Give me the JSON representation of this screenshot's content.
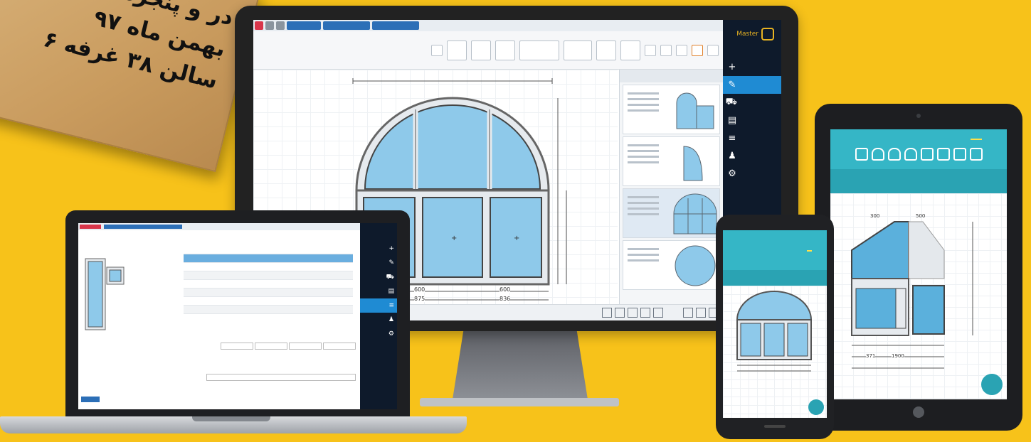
{
  "sign": {
    "line1": "در و پنجره",
    "line2": "بهمن ماه ۹۷",
    "line3": "سالن ۳۸ غرفه ۶"
  },
  "desktop": {
    "brand": "Master",
    "panel_header": "",
    "sidebar": [
      {
        "icon": "plus-icon",
        "glyph": "+",
        "active": false
      },
      {
        "icon": "pencil-icon",
        "glyph": "✎",
        "active": true
      },
      {
        "icon": "cart-icon",
        "glyph": "⛟",
        "active": false
      },
      {
        "icon": "document-icon",
        "glyph": "▤",
        "active": false
      },
      {
        "icon": "list-icon",
        "glyph": "≡",
        "active": false
      },
      {
        "icon": "user-icon",
        "glyph": "♟",
        "active": false
      },
      {
        "icon": "gear-icon",
        "glyph": "⚙",
        "active": false
      }
    ],
    "dimensions": {
      "bottom_row1_left": "600",
      "bottom_row1_right": "600",
      "bottom_row2_left": "875",
      "bottom_row2_right": "836"
    }
  },
  "laptop": {
    "sidebar": [
      {
        "icon": "plus-icon",
        "glyph": "+",
        "active": false
      },
      {
        "icon": "pencil-icon",
        "glyph": "✎",
        "active": false
      },
      {
        "icon": "cart-icon",
        "glyph": "⛟",
        "active": false
      },
      {
        "icon": "document-icon",
        "glyph": "▤",
        "active": false
      },
      {
        "icon": "list-icon",
        "glyph": "≡",
        "active": true
      },
      {
        "icon": "user-icon",
        "glyph": "♟",
        "active": false
      },
      {
        "icon": "gear-icon",
        "glyph": "⚙",
        "active": false
      }
    ]
  },
  "tablet": {
    "fab_label": "",
    "dims": {
      "top_a": "300",
      "top_b": "500",
      "bottom_a": "371",
      "bottom_b": "1900"
    }
  },
  "phone": {
    "dims": {
      "a": "",
      "b": ""
    }
  },
  "colors": {
    "background": "#f7c21a",
    "glass": "#8ec9ea",
    "accent": "#1f8bd3",
    "teal": "#35b6c6"
  }
}
